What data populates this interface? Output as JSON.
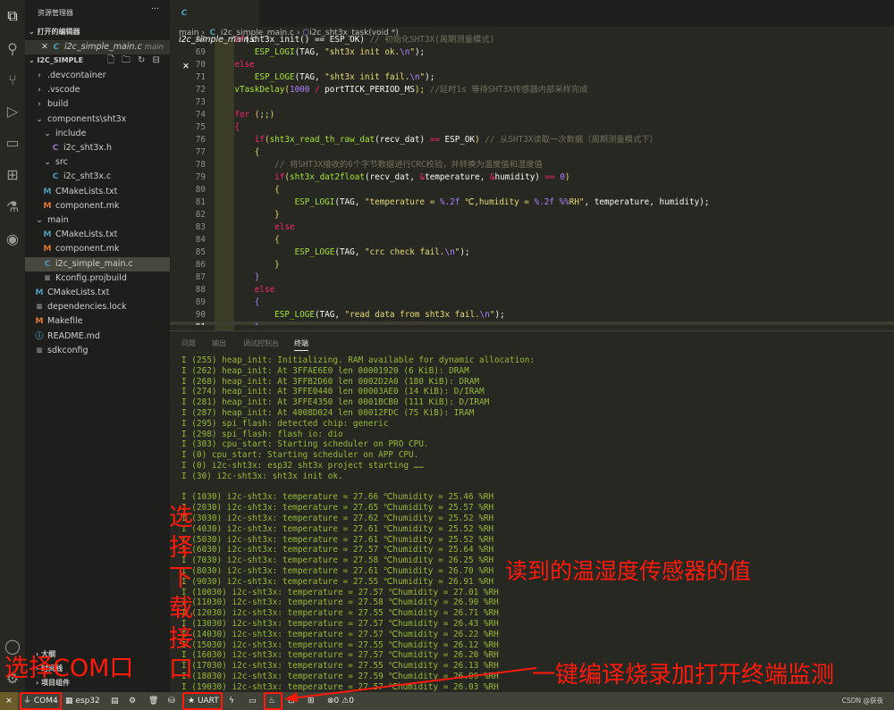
{
  "activity_bar": {
    "icons": [
      "files-icon",
      "search-icon",
      "source-control-icon",
      "run-debug-icon",
      "remote-explorer-icon",
      "extensions-icon",
      "testing-icon",
      "esp-idf-icon",
      "account-icon",
      "gear-icon"
    ]
  },
  "sidebar": {
    "title": "资源管理器",
    "more": "···",
    "open_editors_label": "打开的编辑器",
    "open_editor": {
      "name": "i2c_simple_main.c",
      "folder": "main"
    },
    "project_label": "I2C_SIMPLE",
    "tree": [
      {
        "label": ".devcontainer",
        "type": "folder",
        "chev": "›",
        "depth": 0
      },
      {
        "label": ".vscode",
        "type": "folder",
        "chev": "›",
        "depth": 0
      },
      {
        "label": "build",
        "type": "folder",
        "chev": "›",
        "depth": 0
      },
      {
        "label": "components\\sht3x",
        "type": "folder",
        "chev": "⌄",
        "depth": 0
      },
      {
        "label": "include",
        "type": "folder",
        "chev": "⌄",
        "depth": 1
      },
      {
        "label": "i2c_sht3x.h",
        "type": "h",
        "depth": 2
      },
      {
        "label": "src",
        "type": "folder",
        "chev": "⌄",
        "depth": 1
      },
      {
        "label": "i2c_sht3x.c",
        "type": "c",
        "depth": 2
      },
      {
        "label": "CMakeLists.txt",
        "type": "cm",
        "depth": 1
      },
      {
        "label": "component.mk",
        "type": "m",
        "depth": 1
      },
      {
        "label": "main",
        "type": "folder",
        "chev": "⌄",
        "depth": 0
      },
      {
        "label": "CMakeLists.txt",
        "type": "cm",
        "depth": 1
      },
      {
        "label": "component.mk",
        "type": "m",
        "depth": 1
      },
      {
        "label": "i2c_simple_main.c",
        "type": "c",
        "depth": 1,
        "selected": true
      },
      {
        "label": "Kconfig.projbuild",
        "type": "t",
        "depth": 1
      },
      {
        "label": "CMakeLists.txt",
        "type": "cm",
        "depth": 0
      },
      {
        "label": "dependencies.lock",
        "type": "t",
        "depth": 0
      },
      {
        "label": "Makefile",
        "type": "m",
        "depth": 0
      },
      {
        "label": "README.md",
        "type": "i",
        "depth": 0
      },
      {
        "label": "sdkconfig",
        "type": "t",
        "depth": 0
      }
    ],
    "bottom_sections": [
      "大纲",
      "时间线",
      "项目组件"
    ]
  },
  "editor": {
    "tab": "i2c_simple_main.c",
    "breadcrumb": [
      "main",
      "i2c_simple_main.c",
      "i2c_sht3x_task(void *)"
    ],
    "current_line": 91,
    "lines": [
      {
        "n": 68,
        "t": [
          [
            "    ",
            ""
          ],
          [
            "if",
            "k"
          ],
          [
            "(sht3x_init() == ESP_OK) ",
            "p"
          ],
          [
            "// 初始化SHT3X(周期测量模式)",
            "cm"
          ]
        ]
      },
      {
        "n": 69,
        "t": [
          [
            "        ",
            ""
          ],
          [
            "ESP_LOGI",
            "f"
          ],
          [
            "(TAG, ",
            "p"
          ],
          [
            "\"sht3x init ok.",
            "s"
          ],
          [
            "\\n",
            "n"
          ],
          [
            "\"",
            "s"
          ],
          [
            ");",
            "p"
          ]
        ]
      },
      {
        "n": 70,
        "t": [
          [
            "    ",
            ""
          ],
          [
            "else",
            "k"
          ]
        ]
      },
      {
        "n": 71,
        "t": [
          [
            "        ",
            ""
          ],
          [
            "ESP_LOGE",
            "f"
          ],
          [
            "(TAG, ",
            "p"
          ],
          [
            "\"sht3x init fail.",
            "s"
          ],
          [
            "\\n",
            "n"
          ],
          [
            "\"",
            "s"
          ],
          [
            ");",
            "p"
          ]
        ]
      },
      {
        "n": 72,
        "t": [
          [
            "    ",
            ""
          ],
          [
            "vTaskDelay",
            "f"
          ],
          [
            "(",
            "b"
          ],
          [
            "1000",
            "n"
          ],
          [
            " / ",
            "k"
          ],
          [
            "portTICK_PERIOD_MS",
            "p"
          ],
          [
            ");",
            "b"
          ],
          [
            " //延时1s 等待SHT3X传感器内部采样完成",
            "cm"
          ]
        ]
      },
      {
        "n": 73,
        "t": []
      },
      {
        "n": 74,
        "t": [
          [
            "    ",
            ""
          ],
          [
            "for",
            "k"
          ],
          [
            " (;;)",
            "b"
          ]
        ]
      },
      {
        "n": 75,
        "t": [
          [
            "    ",
            ""
          ],
          [
            "{",
            "k"
          ]
        ]
      },
      {
        "n": 76,
        "t": [
          [
            "        ",
            ""
          ],
          [
            "if",
            "k"
          ],
          [
            "(",
            "b"
          ],
          [
            "sht3x_read_th_raw_dat",
            "f"
          ],
          [
            "(recv_dat) ",
            "p"
          ],
          [
            "==",
            "k"
          ],
          [
            " ESP_OK",
            "p"
          ],
          [
            ")",
            "b"
          ],
          [
            " // 从SHT3X读取一次数据（周期测量模式下）",
            "cm"
          ]
        ]
      },
      {
        "n": 77,
        "t": [
          [
            "        ",
            ""
          ],
          [
            "{",
            "b"
          ]
        ]
      },
      {
        "n": 78,
        "t": [
          [
            "            ",
            ""
          ],
          [
            "// 将SHT3X接收的6个字节数据进行CRC校验，并转换为温度值和湿度值",
            "cm"
          ]
        ]
      },
      {
        "n": 79,
        "t": [
          [
            "            ",
            ""
          ],
          [
            "if",
            "k"
          ],
          [
            "(",
            "b"
          ],
          [
            "sht3x_dat2float",
            "f"
          ],
          [
            "(recv_dat, ",
            "p"
          ],
          [
            "&",
            "k"
          ],
          [
            "temperature, ",
            "p"
          ],
          [
            "&",
            "k"
          ],
          [
            "humidity) ",
            "p"
          ],
          [
            "==",
            "k"
          ],
          [
            " ",
            "p"
          ],
          [
            "0",
            "n"
          ],
          [
            ")",
            "b"
          ]
        ]
      },
      {
        "n": 80,
        "t": [
          [
            "            ",
            ""
          ],
          [
            "{",
            "b"
          ]
        ]
      },
      {
        "n": 81,
        "t": [
          [
            "                ",
            ""
          ],
          [
            "ESP_LOGI",
            "f"
          ],
          [
            "(TAG, ",
            "p"
          ],
          [
            "\"temperature = ",
            "s"
          ],
          [
            "%.2f",
            "n"
          ],
          [
            " ℃,humidity = ",
            "s"
          ],
          [
            "%.2f",
            "n"
          ],
          [
            " ",
            "s"
          ],
          [
            "%%",
            "n"
          ],
          [
            "RH\"",
            "s"
          ],
          [
            ", temperature, humidity);",
            "p"
          ]
        ]
      },
      {
        "n": 82,
        "t": [
          [
            "            ",
            ""
          ],
          [
            "}",
            "b"
          ]
        ]
      },
      {
        "n": 83,
        "t": [
          [
            "            ",
            ""
          ],
          [
            "else",
            "k"
          ]
        ]
      },
      {
        "n": 84,
        "t": [
          [
            "            ",
            ""
          ],
          [
            "{",
            "b"
          ]
        ]
      },
      {
        "n": 85,
        "t": [
          [
            "                ",
            ""
          ],
          [
            "ESP_LOGE",
            "f"
          ],
          [
            "(TAG, ",
            "p"
          ],
          [
            "\"crc check fail.",
            "s"
          ],
          [
            "\\n",
            "n"
          ],
          [
            "\"",
            "s"
          ],
          [
            ");",
            "p"
          ]
        ]
      },
      {
        "n": 86,
        "t": [
          [
            "            ",
            ""
          ],
          [
            "}",
            "b"
          ]
        ]
      },
      {
        "n": 87,
        "t": [
          [
            "        ",
            ""
          ],
          [
            "}",
            "n"
          ]
        ]
      },
      {
        "n": 88,
        "t": [
          [
            "        ",
            ""
          ],
          [
            "else",
            "k"
          ]
        ]
      },
      {
        "n": 89,
        "t": [
          [
            "        ",
            ""
          ],
          [
            "{",
            "n"
          ]
        ]
      },
      {
        "n": 90,
        "t": [
          [
            "            ",
            ""
          ],
          [
            "ESP_LOGE",
            "f"
          ],
          [
            "(TAG, ",
            "p"
          ],
          [
            "\"read data from sht3x fail.",
            "s"
          ],
          [
            "\\n",
            "n"
          ],
          [
            "\"",
            "s"
          ],
          [
            ");",
            "p"
          ]
        ]
      },
      {
        "n": 91,
        "t": [
          [
            "        ",
            ""
          ],
          [
            "}",
            "n"
          ]
        ]
      }
    ]
  },
  "panel": {
    "tabs": [
      "问题",
      "输出",
      "调试控制台",
      "终端"
    ],
    "active_tab": "终端",
    "terminal": [
      "I (255) heap_init: Initializing. RAM available for dynamic allocation:",
      "I (262) heap_init: At 3FFAE6E0 len 00001920 (6 KiB): DRAM",
      "I (268) heap_init: At 3FFB2D60 len 0002D2A0 (180 KiB): DRAM",
      "I (274) heap_init: At 3FFE0440 len 00003AE0 (14 KiB): D/IRAM",
      "I (281) heap_init: At 3FFE4350 len 0001BCB0 (111 KiB): D/IRAM",
      "I (287) heap_init: At 4008D024 len 00012FDC (75 KiB): IRAM",
      "I (295) spi_flash: detected chip: generic",
      "I (298) spi_flash: flash io: dio",
      "I (303) cpu_start: Starting scheduler on PRO CPU.",
      "I (0) cpu_start: Starting scheduler on APP CPU.",
      "I (0) i2c-sht3x: esp32 sht3x project starting ……",
      "I (30) i2c-sht3x: sht3x init ok.",
      "",
      "I (1030) i2c-sht3x: temperature = 27.66 ℃humidity = 25.46 %RH",
      "I (2030) i2c-sht3x: temperature = 27.65 ℃humidity = 25.57 %RH",
      "I (3030) i2c-sht3x: temperature = 27.62 ℃humidity = 25.52 %RH",
      "I (4030) i2c-sht3x: temperature = 27.61 ℃humidity = 25.52 %RH",
      "I (5030) i2c-sht3x: temperature = 27.61 ℃humidity = 25.52 %RH",
      "I (6030) i2c-sht3x: temperature = 27.57 ℃humidity = 25.64 %RH",
      "I (7030) i2c-sht3x: temperature = 27.58 ℃humidity = 26.25 %RH",
      "I (8030) i2c-sht3x: temperature = 27.61 ℃humidity = 26.70 %RH",
      "I (9030) i2c-sht3x: temperature = 27.55 ℃humidity = 26.91 %RH",
      "I (10030) i2c-sht3x: temperature = 27.57 ℃humidity = 27.01 %RH",
      "I (11030) i2c-sht3x: temperature = 27.58 ℃humidity = 26.90 %RH",
      "I (12030) i2c-sht3x: temperature = 27.55 ℃humidity = 26.71 %RH",
      "I (13030) i2c-sht3x: temperature = 27.57 ℃humidity = 26.43 %RH",
      "I (14030) i2c-sht3x: temperature = 27.57 ℃humidity = 26.22 %RH",
      "I (15030) i2c-sht3x: temperature = 27.55 ℃humidity = 26.12 %RH",
      "I (16030) i2c-sht3x: temperature = 27.57 ℃humidity = 26.20 %RH",
      "I (17030) i2c-sht3x: temperature = 27.55 ℃humidity = 26.13 %RH",
      "I (18030) i2c-sht3x: temperature = 27.59 ℃humidity = 26.09 %RH",
      "I (19030) i2c-sht3x: temperature = 27.57 ℃humidity = 26.03 %RH"
    ]
  },
  "status_bar": {
    "remote": "⨯",
    "port": "COM4",
    "target": "esp32",
    "flash_method": "UART",
    "errors": "0",
    "warnings": "0",
    "watermark": "CSDN @获夜"
  },
  "annotations": {
    "select_port": "选择COM口",
    "select_download_interface": [
      "选",
      "择",
      "下",
      "载",
      "接",
      "口"
    ],
    "sensor_values": "读到的温湿度传感器的值",
    "build_flash_monitor": "一键编译烧录加打开终端监测",
    "color": "#ff1a0a"
  }
}
